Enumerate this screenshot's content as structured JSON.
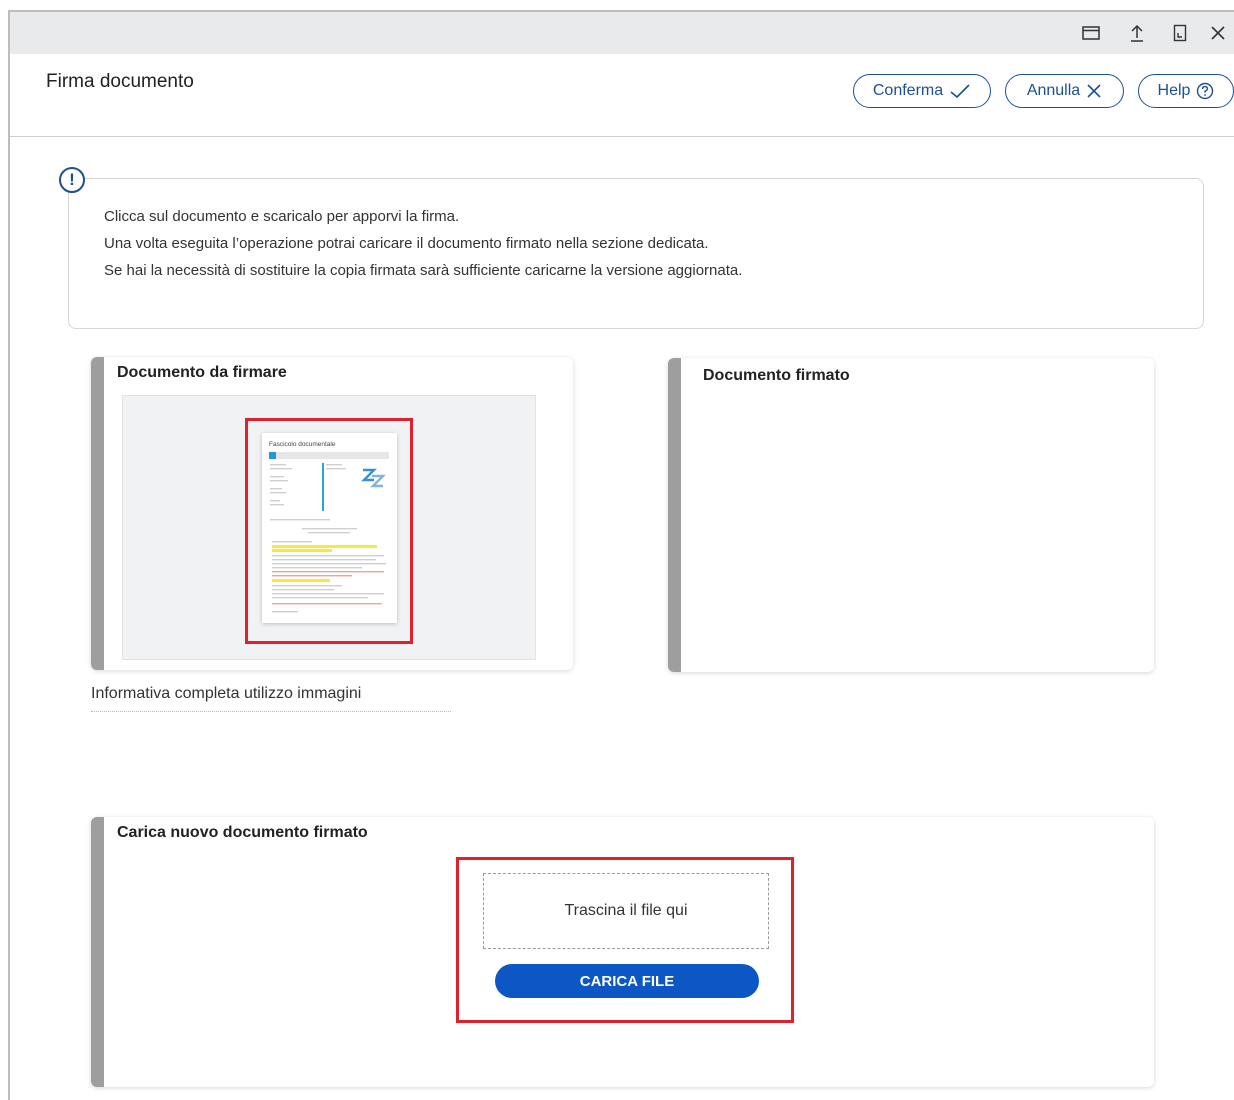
{
  "window": {
    "icons": [
      "window-icon",
      "upload-arrow-icon",
      "bookmark-icon",
      "close-icon"
    ]
  },
  "header": {
    "title": "Firma documento",
    "confirm_label": "Conferma",
    "cancel_label": "Annulla",
    "help_label": "Help"
  },
  "info": {
    "line1": "Clicca sul documento e scaricalo per apporvi la firma.",
    "line2": "Una volta eseguita l’operazione potrai caricare il documento firmato nella sezione dedicata.",
    "line3": "Se hai la necessità di sostituire la copia firmata sarà sufficiente caricarne la versione aggiornata."
  },
  "doc_to_sign": {
    "title": "Documento da firmare",
    "thumbnail_heading": "Fascicolo documentale"
  },
  "doc_signed": {
    "title": "Documento firmato"
  },
  "info_link": "Informativa completa utilizzo immagini",
  "upload": {
    "title": "Carica nuovo documento firmato",
    "dropzone_text": "Trascina il file qui",
    "button_label": "CARICA FILE"
  },
  "colors": {
    "accent": "#1d4f91",
    "primary_button": "#0c57c4",
    "highlight": "#e0202a",
    "card_bar": "#9e9e9e"
  }
}
